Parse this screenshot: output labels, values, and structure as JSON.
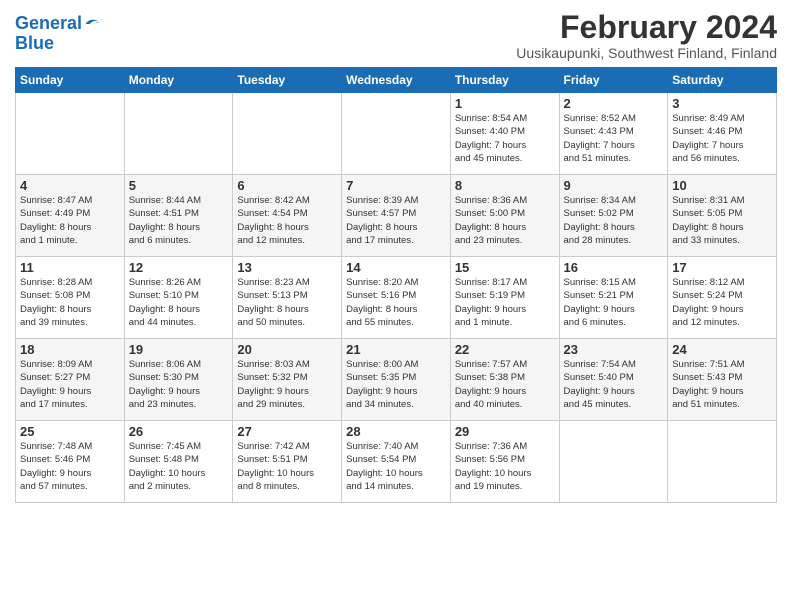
{
  "logo": {
    "line1": "General",
    "line2": "Blue"
  },
  "title": "February 2024",
  "location": "Uusikaupunki, Southwest Finland, Finland",
  "days_header": [
    "Sunday",
    "Monday",
    "Tuesday",
    "Wednesday",
    "Thursday",
    "Friday",
    "Saturday"
  ],
  "weeks": [
    [
      {
        "day": "",
        "info": ""
      },
      {
        "day": "",
        "info": ""
      },
      {
        "day": "",
        "info": ""
      },
      {
        "day": "",
        "info": ""
      },
      {
        "day": "1",
        "info": "Sunrise: 8:54 AM\nSunset: 4:40 PM\nDaylight: 7 hours\nand 45 minutes."
      },
      {
        "day": "2",
        "info": "Sunrise: 8:52 AM\nSunset: 4:43 PM\nDaylight: 7 hours\nand 51 minutes."
      },
      {
        "day": "3",
        "info": "Sunrise: 8:49 AM\nSunset: 4:46 PM\nDaylight: 7 hours\nand 56 minutes."
      }
    ],
    [
      {
        "day": "4",
        "info": "Sunrise: 8:47 AM\nSunset: 4:49 PM\nDaylight: 8 hours\nand 1 minute."
      },
      {
        "day": "5",
        "info": "Sunrise: 8:44 AM\nSunset: 4:51 PM\nDaylight: 8 hours\nand 6 minutes."
      },
      {
        "day": "6",
        "info": "Sunrise: 8:42 AM\nSunset: 4:54 PM\nDaylight: 8 hours\nand 12 minutes."
      },
      {
        "day": "7",
        "info": "Sunrise: 8:39 AM\nSunset: 4:57 PM\nDaylight: 8 hours\nand 17 minutes."
      },
      {
        "day": "8",
        "info": "Sunrise: 8:36 AM\nSunset: 5:00 PM\nDaylight: 8 hours\nand 23 minutes."
      },
      {
        "day": "9",
        "info": "Sunrise: 8:34 AM\nSunset: 5:02 PM\nDaylight: 8 hours\nand 28 minutes."
      },
      {
        "day": "10",
        "info": "Sunrise: 8:31 AM\nSunset: 5:05 PM\nDaylight: 8 hours\nand 33 minutes."
      }
    ],
    [
      {
        "day": "11",
        "info": "Sunrise: 8:28 AM\nSunset: 5:08 PM\nDaylight: 8 hours\nand 39 minutes."
      },
      {
        "day": "12",
        "info": "Sunrise: 8:26 AM\nSunset: 5:10 PM\nDaylight: 8 hours\nand 44 minutes."
      },
      {
        "day": "13",
        "info": "Sunrise: 8:23 AM\nSunset: 5:13 PM\nDaylight: 8 hours\nand 50 minutes."
      },
      {
        "day": "14",
        "info": "Sunrise: 8:20 AM\nSunset: 5:16 PM\nDaylight: 8 hours\nand 55 minutes."
      },
      {
        "day": "15",
        "info": "Sunrise: 8:17 AM\nSunset: 5:19 PM\nDaylight: 9 hours\nand 1 minute."
      },
      {
        "day": "16",
        "info": "Sunrise: 8:15 AM\nSunset: 5:21 PM\nDaylight: 9 hours\nand 6 minutes."
      },
      {
        "day": "17",
        "info": "Sunrise: 8:12 AM\nSunset: 5:24 PM\nDaylight: 9 hours\nand 12 minutes."
      }
    ],
    [
      {
        "day": "18",
        "info": "Sunrise: 8:09 AM\nSunset: 5:27 PM\nDaylight: 9 hours\nand 17 minutes."
      },
      {
        "day": "19",
        "info": "Sunrise: 8:06 AM\nSunset: 5:30 PM\nDaylight: 9 hours\nand 23 minutes."
      },
      {
        "day": "20",
        "info": "Sunrise: 8:03 AM\nSunset: 5:32 PM\nDaylight: 9 hours\nand 29 minutes."
      },
      {
        "day": "21",
        "info": "Sunrise: 8:00 AM\nSunset: 5:35 PM\nDaylight: 9 hours\nand 34 minutes."
      },
      {
        "day": "22",
        "info": "Sunrise: 7:57 AM\nSunset: 5:38 PM\nDaylight: 9 hours\nand 40 minutes."
      },
      {
        "day": "23",
        "info": "Sunrise: 7:54 AM\nSunset: 5:40 PM\nDaylight: 9 hours\nand 45 minutes."
      },
      {
        "day": "24",
        "info": "Sunrise: 7:51 AM\nSunset: 5:43 PM\nDaylight: 9 hours\nand 51 minutes."
      }
    ],
    [
      {
        "day": "25",
        "info": "Sunrise: 7:48 AM\nSunset: 5:46 PM\nDaylight: 9 hours\nand 57 minutes."
      },
      {
        "day": "26",
        "info": "Sunrise: 7:45 AM\nSunset: 5:48 PM\nDaylight: 10 hours\nand 2 minutes."
      },
      {
        "day": "27",
        "info": "Sunrise: 7:42 AM\nSunset: 5:51 PM\nDaylight: 10 hours\nand 8 minutes."
      },
      {
        "day": "28",
        "info": "Sunrise: 7:40 AM\nSunset: 5:54 PM\nDaylight: 10 hours\nand 14 minutes."
      },
      {
        "day": "29",
        "info": "Sunrise: 7:36 AM\nSunset: 5:56 PM\nDaylight: 10 hours\nand 19 minutes."
      },
      {
        "day": "",
        "info": ""
      },
      {
        "day": "",
        "info": ""
      }
    ]
  ]
}
